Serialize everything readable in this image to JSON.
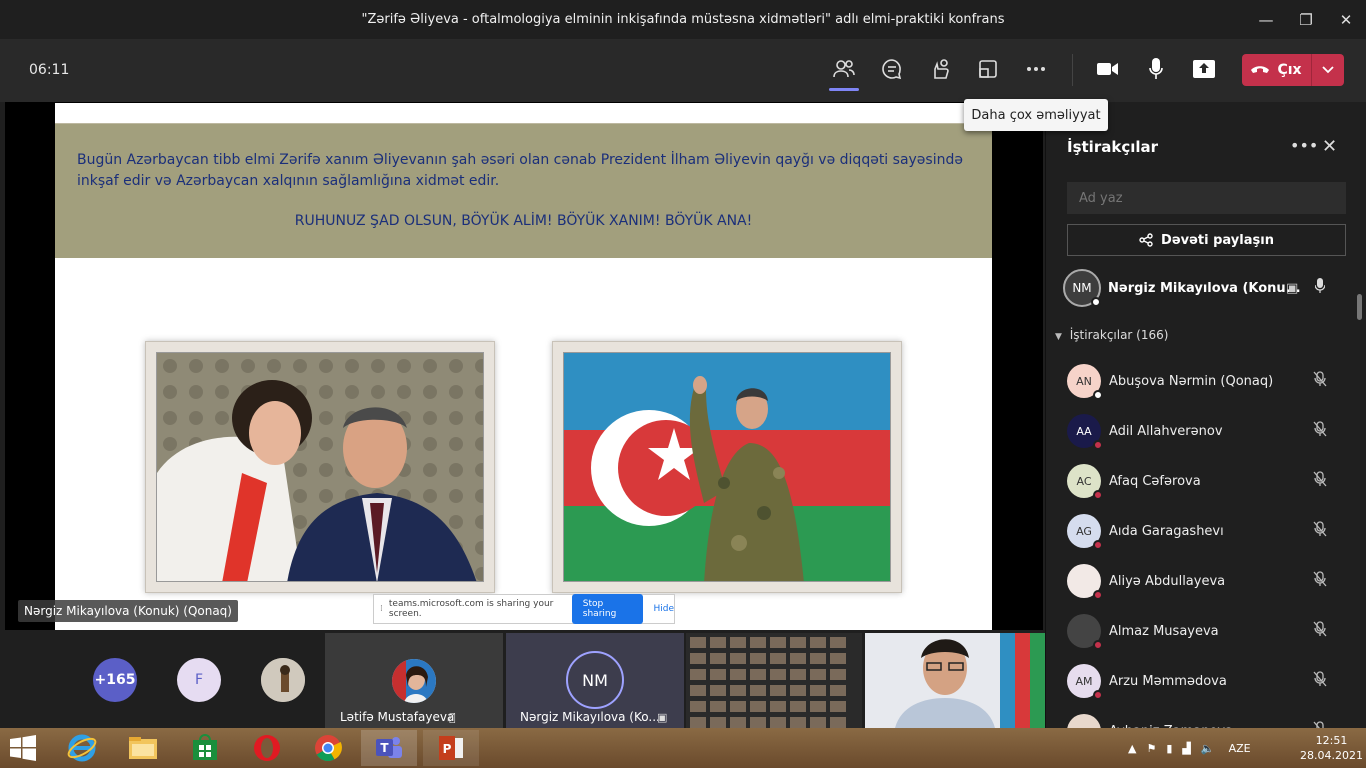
{
  "window": {
    "title": "\"Zərifə Əliyeva - oftalmologiya elminin inkişafında müstəsna xidmətləri\" adlı elmi-praktiki konfrans",
    "minimize": "—",
    "maximize": "❐",
    "close": "✕"
  },
  "toolbar": {
    "timer": "06:11",
    "leave_label": "Çıx",
    "tooltip": "Daha çox əməliyyat"
  },
  "slide": {
    "paragraph": "Bugün Azərbaycan tibb elmi Zərifə xanım Əliyevanın şah əsəri olan cənab Prezident İlham Əliyevin qayğı və diqqəti sayəsində inkşaf edir və Azərbaycan xalqının sağlamlığına xidmət edir.",
    "cheer": "RUHUNUZ ŞAD OLSUN, BÖYÜK ALİM! BÖYÜK XANIM! BÖYÜK ANA!"
  },
  "share_bar": {
    "text": "teams.microsoft.com is sharing your screen.",
    "stop_label": "Stop sharing",
    "hide_label": "Hide"
  },
  "stage": {
    "presenter_name": "Nərgiz Mikayılova (Konuk) (Qonaq)"
  },
  "strip": {
    "more_count": "+165",
    "avatar_f": "F",
    "tile1_name": "Lətifə Mustafayeva",
    "tile2_initials": "NM",
    "tile2_name": "Nərgiz Mikayılova (Ko..."
  },
  "panel": {
    "title": "İştirakçılar",
    "search_placeholder": "Ad yaz",
    "invite_label": "Dəvəti paylaşın",
    "presenter": {
      "initials": "NM",
      "name": "Nərgiz Mikayılova (Konu..."
    },
    "section_label": "İştirakçılar (166)",
    "participants": [
      {
        "initials": "AN",
        "name": "Abuşova Nərmin (Qonaq)",
        "bg": "#f6d3c9"
      },
      {
        "initials": "AA",
        "name": "Adil Allahverənov",
        "bg": "#1a1a4a"
      },
      {
        "initials": "AC",
        "name": "Afaq Cəfərova",
        "bg": "#dde3c8"
      },
      {
        "initials": "AG",
        "name": "Aıda Garagashevı",
        "bg": "#d5dcee"
      },
      {
        "initials": "",
        "name": "Aliyə Abdullayeva",
        "bg": "#f2e9e6"
      },
      {
        "initials": "",
        "name": "Almaz Musayeva",
        "bg": "#444444"
      },
      {
        "initials": "AM",
        "name": "Arzu Məmmədova",
        "bg": "#e6dcee"
      },
      {
        "initials": "",
        "name": "Ayhaniz Zamanova",
        "bg": "#e8d8cc"
      }
    ]
  },
  "taskbar": {
    "lang": "AZE",
    "time": "12:51",
    "date": "28.04.2021"
  }
}
